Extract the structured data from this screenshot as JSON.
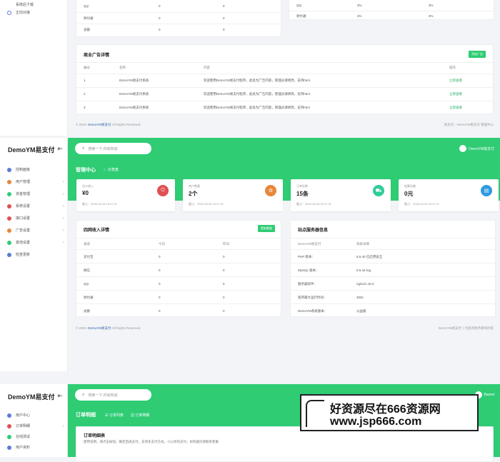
{
  "top_section": {
    "sidebar_items": [
      {
        "label": "系统后下载"
      },
      {
        "label": "正向对接"
      }
    ],
    "left_table": {
      "rows": [
        {
          "name": "QQ",
          "a": "0",
          "b": "0"
        },
        {
          "name": "财付通",
          "a": "0",
          "b": "0"
        },
        {
          "name": "总额",
          "a": "0",
          "b": "0"
        }
      ]
    },
    "right_table": {
      "rows": [
        {
          "name": "QQ",
          "a": "3%",
          "b": "3%"
        },
        {
          "name": "财付通",
          "a": "3%",
          "b": "3%"
        }
      ]
    },
    "ads": {
      "title": "商业广告详情",
      "button": "添加广告",
      "headers": [
        "编号",
        "名称",
        "内容",
        "操作"
      ],
      "rows": [
        {
          "id": "1",
          "name": "DemoYM易支付系统",
          "content": "欢迎使用DemoYM易支付程序，此处为广告内容，管理员请修改，支持html",
          "action": "立即查看"
        },
        {
          "id": "2",
          "name": "DemoYM易支付系统",
          "content": "欢迎使用DemoYM易支付程序，此处为广告内容，管理员请修改，支持html",
          "action": "立即查看"
        },
        {
          "id": "3",
          "name": "DemoYM易支付系统",
          "content": "欢迎使用DemoYM易支付程序，此处为广告内容，管理员请修改，支持html",
          "action": "立即查看"
        }
      ]
    },
    "footer_left": "© 2020.",
    "footer_brand": "DemoYM易支付",
    "footer_rights": "All Rights Reserved.",
    "footer_right": "易支付：DemoYM易支付 管理中心"
  },
  "mid_section": {
    "brand": "DemoYM易支付",
    "collapse_icon": "menu-fold-icon",
    "search_placeholder": "搜索一下,你就知道",
    "user_name": "DemoYM易支付",
    "page_title": "管理中心",
    "breadcrumb": "仪表盘",
    "sidebar_items": [
      {
        "label": "控制面板",
        "icon": "dashboard-icon",
        "color": "#5b7bd5"
      },
      {
        "label": "用户管理",
        "icon": "user-icon",
        "color": "#e8873a"
      },
      {
        "label": "资金管理",
        "icon": "money-icon",
        "color": "#2fcc74"
      },
      {
        "label": "系统设置",
        "icon": "settings-icon",
        "color": "#e05050"
      },
      {
        "label": "接口设置",
        "icon": "api-icon",
        "color": "#e05050"
      },
      {
        "label": "广告设置",
        "icon": "ad-icon",
        "color": "#e8873a"
      },
      {
        "label": "其他设置",
        "icon": "send-icon",
        "color": "#2fcc74"
      },
      {
        "label": "检查更新",
        "icon": "update-icon",
        "color": "#5b7bd5"
      }
    ],
    "stats": [
      {
        "label": "总计收入",
        "value": "¥0",
        "time": "截止：2020-04-26 10:27:11",
        "color": "#e05050",
        "icon": "power-icon"
      },
      {
        "label": "商户数量",
        "value": "2个",
        "time": "截止：2020-04-26 10:27:11",
        "color": "#e8873a",
        "icon": "settings-icon"
      },
      {
        "label": "订单总数",
        "value": "15条",
        "time": "截止：2020-04-26 10:27:11",
        "color": "#2fcc9a",
        "icon": "cart-icon"
      },
      {
        "label": "结算总额",
        "value": "0元",
        "time": "截止：2020-04-26 10:27:11",
        "color": "#2f9ae0",
        "icon": "wallet-icon"
      }
    ],
    "income": {
      "title": "四网收入详情",
      "button": "更新数据",
      "headers": [
        "通道",
        "今日",
        "昨日"
      ],
      "rows": [
        {
          "name": "支付宝",
          "a": "0",
          "b": "0"
        },
        {
          "name": "微信",
          "a": "0",
          "b": "0"
        },
        {
          "name": "QQ",
          "a": "0",
          "b": "0"
        },
        {
          "name": "财付通",
          "a": "0",
          "b": "0"
        },
        {
          "name": "总额",
          "a": "0",
          "b": "0"
        }
      ]
    },
    "server": {
      "title": "站点服务器信息",
      "headers": [
        "DemoYM易支付",
        "系统详情"
      ],
      "rows": [
        {
          "k": "PHP 版本：",
          "v": "5.6.40 已启用安全"
        },
        {
          "k": "MySQL 版本：",
          "v": "5.6.44-log"
        },
        {
          "k": "服务器软件：",
          "v": "nginx/1.15.0"
        },
        {
          "k": "程序最大运行时间：",
          "v": "300s"
        },
        {
          "k": "DemoYM系统版本：",
          "v": "公益版"
        }
      ]
    },
    "footer_left": "© 2020.",
    "footer_brand": "DemoYM易支付",
    "footer_rights": "All Rights Reserved.",
    "footer_right": "DemoYM易支付丨为您的财务保驾护航"
  },
  "bottom_section": {
    "brand": "DemoYM易支付",
    "search_placeholder": "搜索一下,你就知道",
    "user_name": "Baond",
    "page_title": "订单明细",
    "tabs": [
      "订单列表",
      "订单明细"
    ],
    "sidebar_items": [
      {
        "label": "用户中心",
        "color": "#5b7bd5"
      },
      {
        "label": "订单明细",
        "color": "#e05050"
      },
      {
        "label": "在线测试",
        "color": "#2fcc74"
      },
      {
        "label": "用户资料",
        "color": "#5b7bd5"
      }
    ],
    "card_title": "订单明细表",
    "card_desc": "使用说明，请点击按钮，确定后再支付，支持多支付方式。小心你的支付，如有疑问请联系客服"
  },
  "watermark": {
    "line1": "好资源尽在666资源网",
    "line2": "www.jsp666.com"
  }
}
